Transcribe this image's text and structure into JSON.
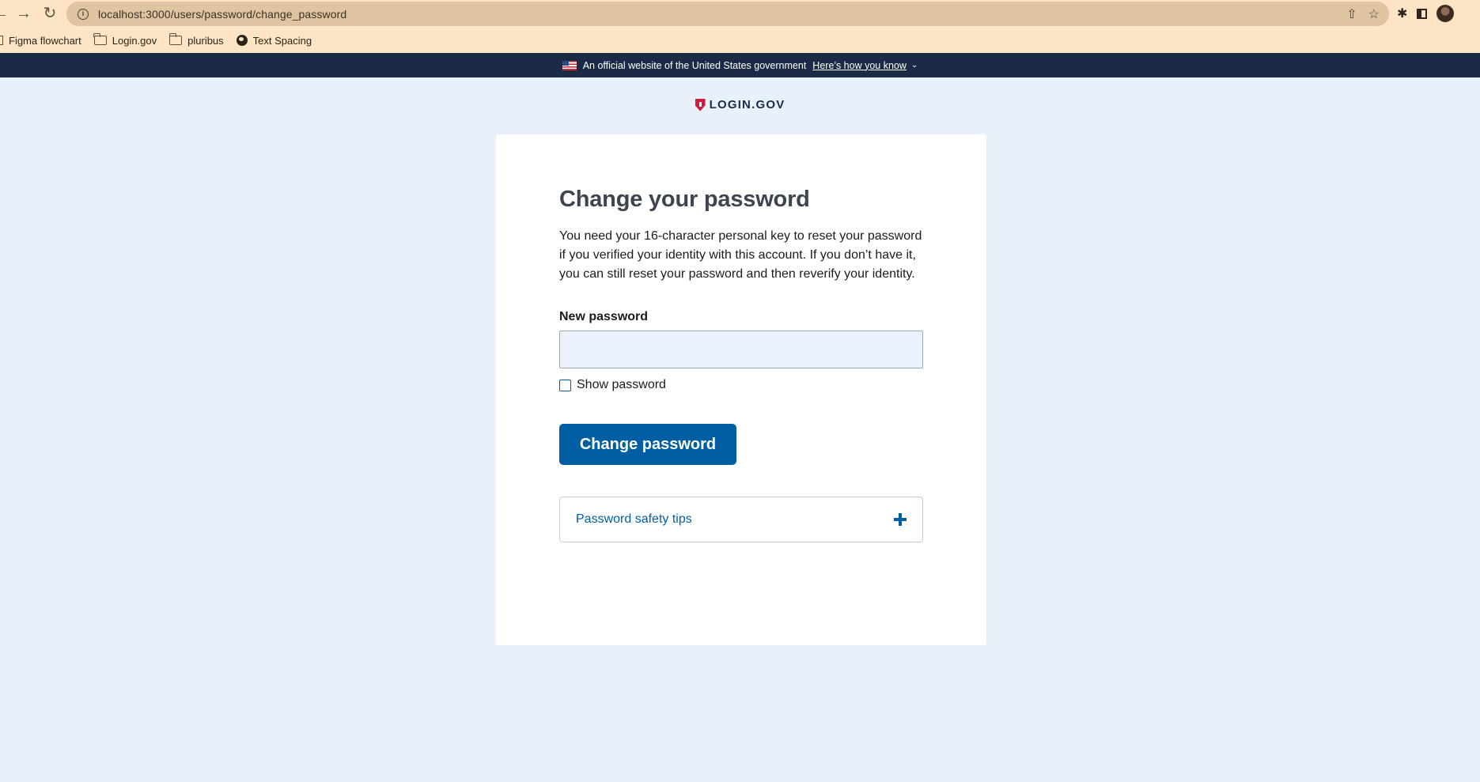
{
  "browser": {
    "url": "localhost:3000/users/password/change_password",
    "bookmarks": [
      {
        "label": "Figma flowchart",
        "icon": "page-icon"
      },
      {
        "label": "Login.gov",
        "icon": "folder-icon"
      },
      {
        "label": "pluribus",
        "icon": "folder-icon"
      },
      {
        "label": "Text Spacing",
        "icon": "globe-icon"
      }
    ]
  },
  "banner": {
    "text": "An official website of the United States government",
    "link": "Here’s how you know"
  },
  "logo": {
    "text": "LOGIN.GOV"
  },
  "form": {
    "title": "Change your password",
    "intro": "You need your 16-character personal key to reset your password if you verified your identity with this account. If you don’t have it, you can still reset your password and then reverify your identity.",
    "password_label": "New password",
    "password_value": "",
    "show_password_label": "Show password",
    "show_password_checked": false,
    "submit_label": "Change password",
    "tips_label": "Password safety tips"
  },
  "colors": {
    "page_bg": "#e8f0fa",
    "banner_bg": "#1b2b45",
    "primary": "#005ea2",
    "brand_red": "#d3183a",
    "chrome_bg": "#fde4c4"
  }
}
